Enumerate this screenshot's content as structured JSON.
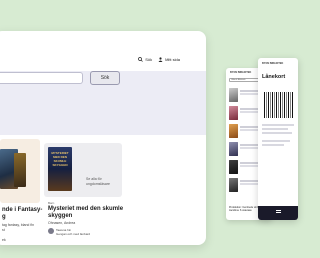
{
  "desktop": {
    "nav": {
      "search_label": "Sök",
      "account_label": "Mitt sida"
    },
    "search": {
      "button_label": "Sök"
    },
    "card1": {
      "title": "nde i Fantasy-",
      "title2": "g",
      "sub": "tag fantasy, bland fin",
      "sub2": "st",
      "footer": "ek"
    },
    "card2": {
      "category": "Barn",
      "cover_title": "MYSTERIET MED DEN SKUMLE SKYGGEN",
      "cta": "Se alla för ungdomsläsare",
      "title": "Mysteriet med den skumle",
      "title2": "skyggen",
      "sub": "Ohnasen, Andrea",
      "author_name": "Tawena hin",
      "author_meta": "Gengan och med fanbard"
    }
  },
  "phone1": {
    "brand": "BYOS BIBLIOTEK",
    "search_label": "Utforsk Bibliotek",
    "footer": "Produktion: Cembede vinforge Jacobine S osteraas"
  },
  "phone2": {
    "brand": "BYOS BIBLIOTEK",
    "title": "Lånekort"
  },
  "colors": {
    "background": "#d7ebd2",
    "search_band": "#ececf5",
    "card_warm": "#f6ede2"
  }
}
